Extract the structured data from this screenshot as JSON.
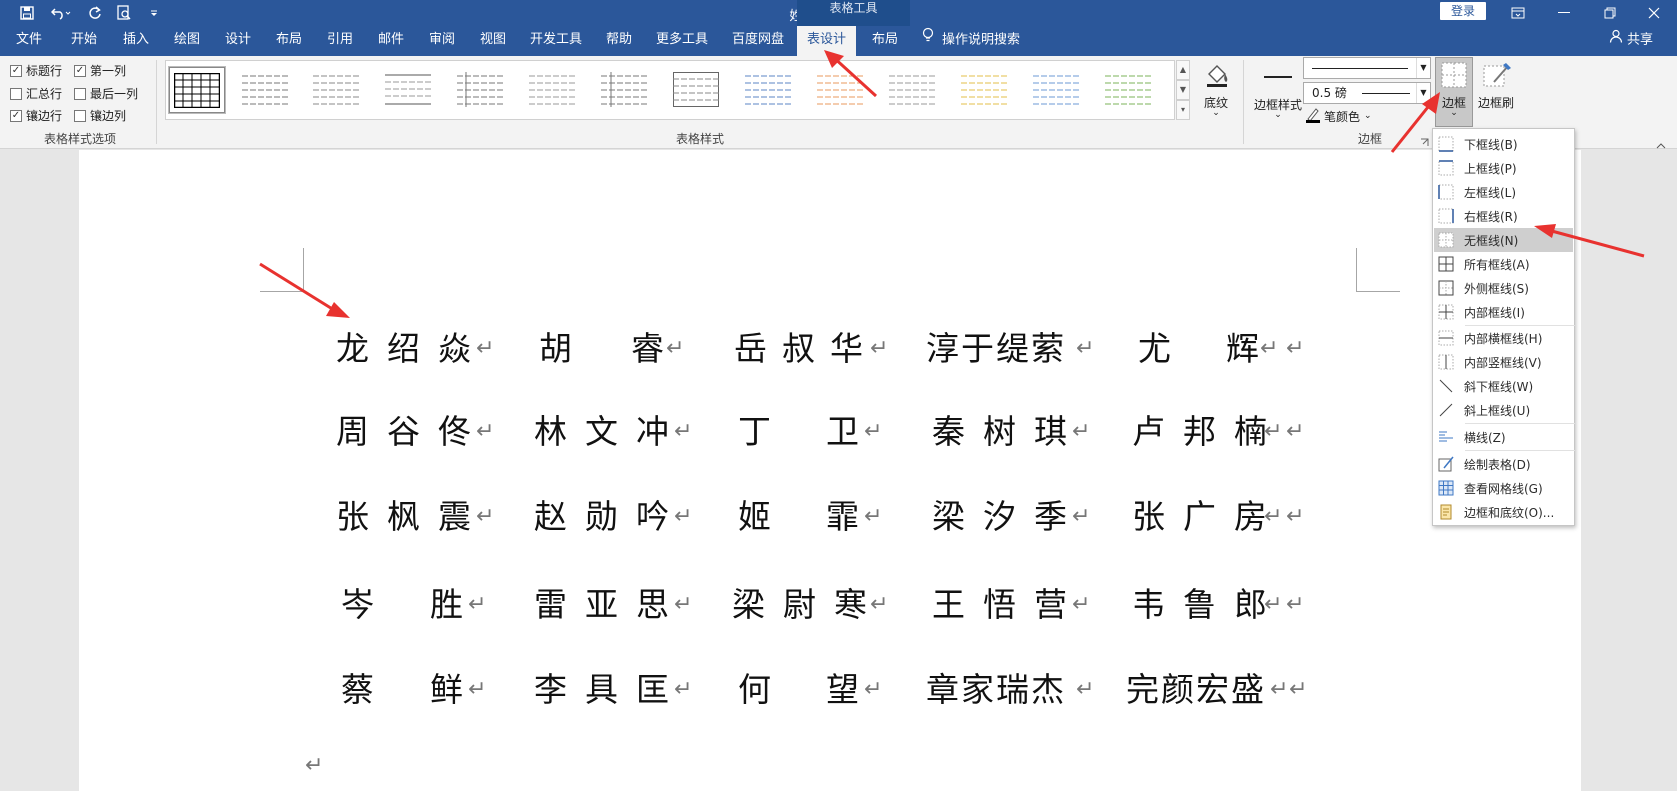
{
  "window": {
    "title": "姓名对齐  -  Word",
    "context_group": "表格工具",
    "login_label": "登录",
    "colors": {
      "titlebar": "#2b579a",
      "ribbon": "#f3f3f3",
      "accent_arrow": "#e8322f"
    }
  },
  "quick_access": {
    "icons": [
      "save-icon",
      "undo-icon",
      "redo-icon",
      "print-preview-icon",
      "customize-icon"
    ]
  },
  "tabs": [
    {
      "label": "文件"
    },
    {
      "label": "开始"
    },
    {
      "label": "插入"
    },
    {
      "label": "绘图"
    },
    {
      "label": "设计"
    },
    {
      "label": "布局"
    },
    {
      "label": "引用"
    },
    {
      "label": "邮件"
    },
    {
      "label": "审阅"
    },
    {
      "label": "视图"
    },
    {
      "label": "开发工具"
    },
    {
      "label": "帮助"
    },
    {
      "label": "更多工具"
    },
    {
      "label": "百度网盘"
    },
    {
      "label": "表设计",
      "active": true
    },
    {
      "label": "布局"
    }
  ],
  "tell_me": "操作说明搜索",
  "share": "共享",
  "ribbon": {
    "style_options": {
      "items": [
        {
          "label": "标题行",
          "checked": true
        },
        {
          "label": "第一列",
          "checked": true
        },
        {
          "label": "汇总行",
          "checked": false
        },
        {
          "label": "最后一列",
          "checked": false
        },
        {
          "label": "镶边行",
          "checked": true
        },
        {
          "label": "镶边列",
          "checked": false
        }
      ],
      "group_label": "表格样式选项"
    },
    "table_styles": {
      "group_label": "表格样式"
    },
    "shading_label": "底纹",
    "border_styles_label": "边框样式",
    "line_weight": "0.5 磅",
    "pen_color_label": "笔颜色",
    "borders_label": "边框",
    "border_painter_label": "边框刷",
    "borders_group_label": "边框"
  },
  "border_menu": [
    {
      "label": "下框线(B)",
      "icon": "bottom-border-icon"
    },
    {
      "label": "上框线(P)",
      "icon": "top-border-icon"
    },
    {
      "label": "左框线(L)",
      "icon": "left-border-icon"
    },
    {
      "label": "右框线(R)",
      "icon": "right-border-icon"
    },
    {
      "label": "无框线(N)",
      "icon": "no-border-icon",
      "highlighted": true
    },
    {
      "label": "所有框线(A)",
      "icon": "all-borders-icon"
    },
    {
      "label": "外侧框线(S)",
      "icon": "outside-borders-icon"
    },
    {
      "label": "内部框线(I)",
      "icon": "inside-borders-icon"
    },
    {
      "label": "内部横框线(H)",
      "icon": "inside-horizontal-border-icon"
    },
    {
      "label": "内部竖框线(V)",
      "icon": "inside-vertical-border-icon"
    },
    {
      "label": "斜下框线(W)",
      "icon": "diagonal-down-border-icon"
    },
    {
      "label": "斜上框线(U)",
      "icon": "diagonal-up-border-icon"
    },
    {
      "label": "横线(Z)",
      "icon": "horizontal-line-icon"
    },
    {
      "label": "绘制表格(D)",
      "icon": "draw-table-icon"
    },
    {
      "label": "查看网格线(G)",
      "icon": "view-gridlines-icon"
    },
    {
      "label": "边框和底纹(O)...",
      "icon": "borders-shading-icon"
    }
  ],
  "table": {
    "paragraph_mark": "↵",
    "row_end_mark": "↵",
    "rows": [
      [
        "龙绍焱",
        "胡睿",
        "岳叔华",
        "淳于缇萦",
        "尤辉"
      ],
      [
        "周谷佟",
        "林文冲",
        "丁卫",
        "秦树琪",
        "卢邦楠"
      ],
      [
        "张枫震",
        "赵勋吟",
        "姬霏",
        "梁汐季",
        "张广房"
      ],
      [
        "岑胜",
        "雷亚思",
        "梁尉寒",
        "王悟营",
        "韦鲁郎"
      ],
      [
        "蔡鲜",
        "李具匡",
        "何望",
        "章家瑞杰",
        "完颜宏盛"
      ]
    ]
  }
}
